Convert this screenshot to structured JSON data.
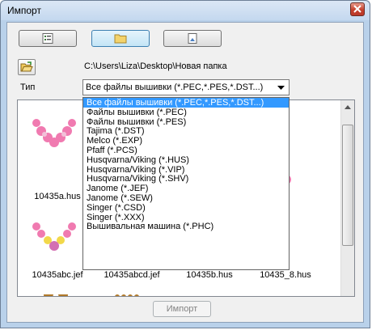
{
  "window": {
    "title": "Импорт"
  },
  "path": "C:\\Users\\Liza\\Desktop\\Новая папка",
  "type_label": "Тип",
  "combo": {
    "selected": "Все файлы вышивки (*.PEC,*.PES,*.DST...)"
  },
  "dropdown": {
    "items": [
      "Все файлы вышивки (*.PEC,*.PES,*.DST...)",
      "Файлы вышивки (*.PEC)",
      "Файлы вышивки (*.PES)",
      "Tajima (*.DST)",
      "Melco (*.EXP)",
      "Pfaff (*.PCS)",
      "Husqvarna/Viking (*.HUS)",
      "Husqvarna/Viking (*.VIP)",
      "Husqvarna/Viking (*.SHV)",
      "Janome (*.JEF)",
      "Janome (*.SEW)",
      "Singer (*.CSD)",
      "Singer (*.XXX)",
      "Вышивальная машина (*.PHC)"
    ]
  },
  "files": {
    "r1c1": "10435a.hus",
    "r2c1": "10435abc.jef",
    "r2c2": "10435abcd.jef",
    "r2c3": "10435b.hus",
    "r2c4": "10435_8.hus"
  },
  "import_button": "Импорт",
  "colors": {
    "selection": "#3399ff",
    "pink": "#f07ab0",
    "yellow": "#f2d84a",
    "brown": "#b27a2a"
  }
}
